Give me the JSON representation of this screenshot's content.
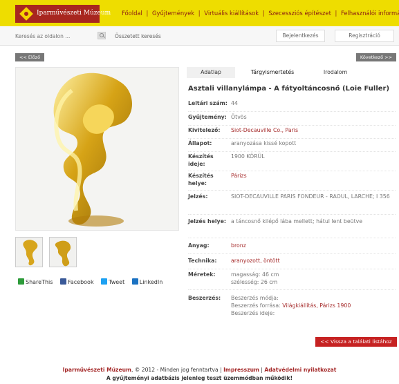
{
  "header": {
    "logo_text": "Iparművészeti Múzeum",
    "nav": [
      "Főoldal",
      "Gyűjtemények",
      "Virtuális kiállítások",
      "Szecessziós építészet",
      "Felhasználói információ"
    ]
  },
  "search": {
    "placeholder": "Keresés az oldalon ...",
    "advanced_label": "Összetett keresés",
    "login_label": "Bejelentkezés",
    "register_label": "Regisztráció"
  },
  "pager": {
    "prev_label": "<< Előző",
    "next_label": "Következő >>"
  },
  "tabs": [
    "Adatlap",
    "Tárgyismertetés",
    "Irodalom"
  ],
  "object": {
    "title": "Asztali villanylámpa - A fátyoltáncosnő (Loie Fuller)",
    "fields": [
      {
        "label": "Leltári szám:",
        "value": "44"
      },
      {
        "label": "Gyűjtemény:",
        "value": "Ötvös"
      },
      {
        "label": "Kivitelező:",
        "value": "Siot-Decauville Co., Paris"
      },
      {
        "label": "Állapot:",
        "value": "aranyozása kissé kopott"
      },
      {
        "label": "Készítés ideje:",
        "value": "1900 KÖRÜL"
      },
      {
        "label": "Készítés helye:",
        "value": "Párizs"
      },
      {
        "label": "Jelzés:",
        "value": "SIOT-DECAUVILLE PARIS FONDEUR - RAOUL, LARCHE; I 356"
      },
      {
        "label": "Jelzés helye:",
        "value": "a táncosnő kilépő lába mellett; hátul lent beütve"
      },
      {
        "label": "Anyag:",
        "value": "bronz"
      },
      {
        "label": "Technika:",
        "value": "aranyozott, öntött"
      },
      {
        "label": "Méretek:",
        "value_lines": [
          "magasság: 46 cm",
          "szélesség: 26 cm"
        ]
      },
      {
        "label": "Beszerzés:",
        "value_lines": [
          "Beszerzés módja:",
          "Beszerzés forrása:",
          "Beszerzés ideje:"
        ],
        "source_value": "Világkiállítás, Párizs 1900"
      }
    ]
  },
  "share": {
    "sharethis": "ShareThis",
    "facebook": "Facebook",
    "tweet": "Tweet",
    "linkedin": "LinkedIn"
  },
  "back_label": "<< Vissza a találati listához",
  "footer": {
    "museum": "Iparművészeti Múzeum",
    "rights": ", © 2012 - Minden jog fenntartva",
    "imprint": "Impresszum",
    "privacy": "Adatvédelmi nyilatkozat",
    "test_notice": "A gyűjteményi adatbázis jelenleg teszt üzemmódban működik!",
    "separator": " | "
  },
  "colors": {
    "topbar": "#eedd00",
    "brand_red": "#a8261f",
    "link_red": "#a52a2a",
    "button_red": "#c62222"
  },
  "icons": {
    "search": "magnifier-icon",
    "logo_mark": "diamond-logo-icon",
    "share": "sharethis-icon",
    "facebook": "facebook-icon",
    "twitter": "twitter-icon",
    "linkedin": "linkedin-icon"
  }
}
